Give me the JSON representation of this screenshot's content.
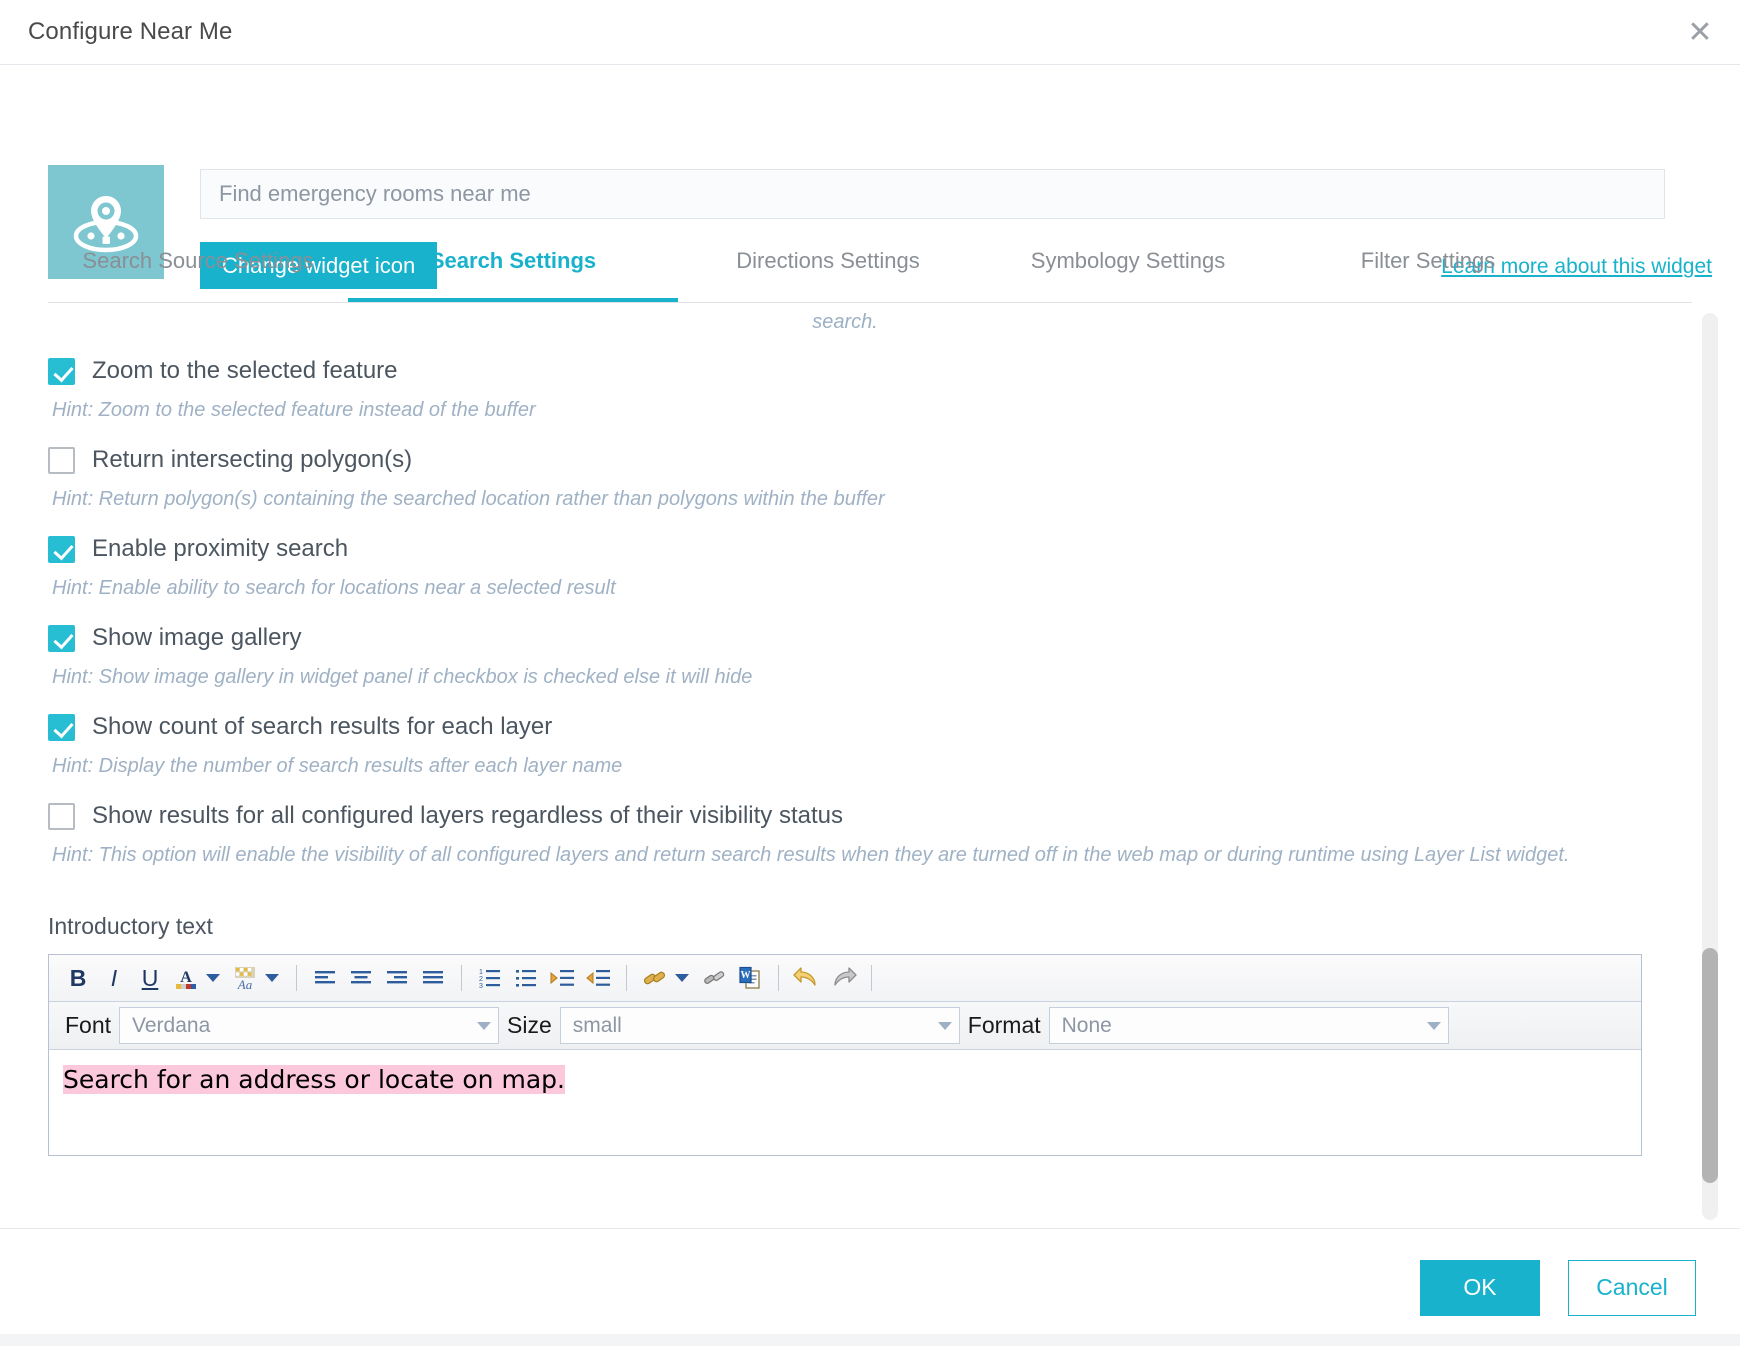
{
  "dialog": {
    "title": "Configure Near Me",
    "close_icon": "close-icon"
  },
  "header": {
    "widget_icon": "near-me-map-pin-icon",
    "name_value": "Find emergency rooms near me",
    "name_placeholder": "Find emergency rooms near me",
    "change_icon_label": "Change widget icon",
    "learn_more_label": "Learn more about this widget"
  },
  "tabs": [
    {
      "label": "Search Source Settings",
      "active": false
    },
    {
      "label": "Search Settings",
      "active": true
    },
    {
      "label": "Directions Settings",
      "active": false
    },
    {
      "label": "Symbology Settings",
      "active": false
    },
    {
      "label": "Filter Settings",
      "active": false
    }
  ],
  "content": {
    "clipped_hint_above": "search.",
    "options": [
      {
        "label": "Zoom to the selected feature",
        "checked": true,
        "hint": "Hint: Zoom to the selected feature instead of the buffer"
      },
      {
        "label": "Return intersecting polygon(s)",
        "checked": false,
        "hint": "Hint: Return polygon(s) containing the searched location rather than polygons within the buffer"
      },
      {
        "label": "Enable proximity search",
        "checked": true,
        "hint": "Hint: Enable ability to search for locations near a selected result"
      },
      {
        "label": "Show image gallery",
        "checked": true,
        "hint": "Hint: Show image gallery in widget panel if checkbox is checked else it will hide"
      },
      {
        "label": "Show count of search results for each layer",
        "checked": true,
        "hint": "Hint: Display the number of search results after each layer name"
      },
      {
        "label": "Show results for all configured layers regardless of their visibility status",
        "checked": false,
        "hint": "Hint: This option will enable the visibility of all configured layers and return search results when they are turned off in the web map or during runtime using Layer List widget."
      }
    ],
    "intro_label": "Introductory text"
  },
  "editor": {
    "toolbar_icons": [
      "bold-icon",
      "italic-icon",
      "underline-icon",
      "font-color-icon",
      "font-color-dropdown-icon",
      "highlight-color-icon",
      "highlight-color-dropdown-icon",
      "align-left-icon",
      "align-center-icon",
      "align-right-icon",
      "align-justify-icon",
      "ordered-list-icon",
      "unordered-list-icon",
      "indent-icon",
      "outdent-icon",
      "insert-link-icon",
      "insert-link-dropdown-icon",
      "remove-link-icon",
      "paste-from-word-icon",
      "undo-icon",
      "redo-icon"
    ],
    "toolbar_labels": {
      "bold": "B",
      "italic": "I",
      "underline": "U"
    },
    "font_label": "Font",
    "font_value": "Verdana",
    "size_label": "Size",
    "size_value": "small",
    "format_label": "Format",
    "format_value": "None",
    "body_text": "Search for an address or locate on map."
  },
  "footer": {
    "ok_label": "OK",
    "cancel_label": "Cancel"
  },
  "colors": {
    "accent": "#18b2cc",
    "checkbox_checked": "#27bed4",
    "widget_icon_bg": "#7ec6d0",
    "hint_text": "#9fb1c4",
    "selection_highlight": "#fcc8dc"
  }
}
